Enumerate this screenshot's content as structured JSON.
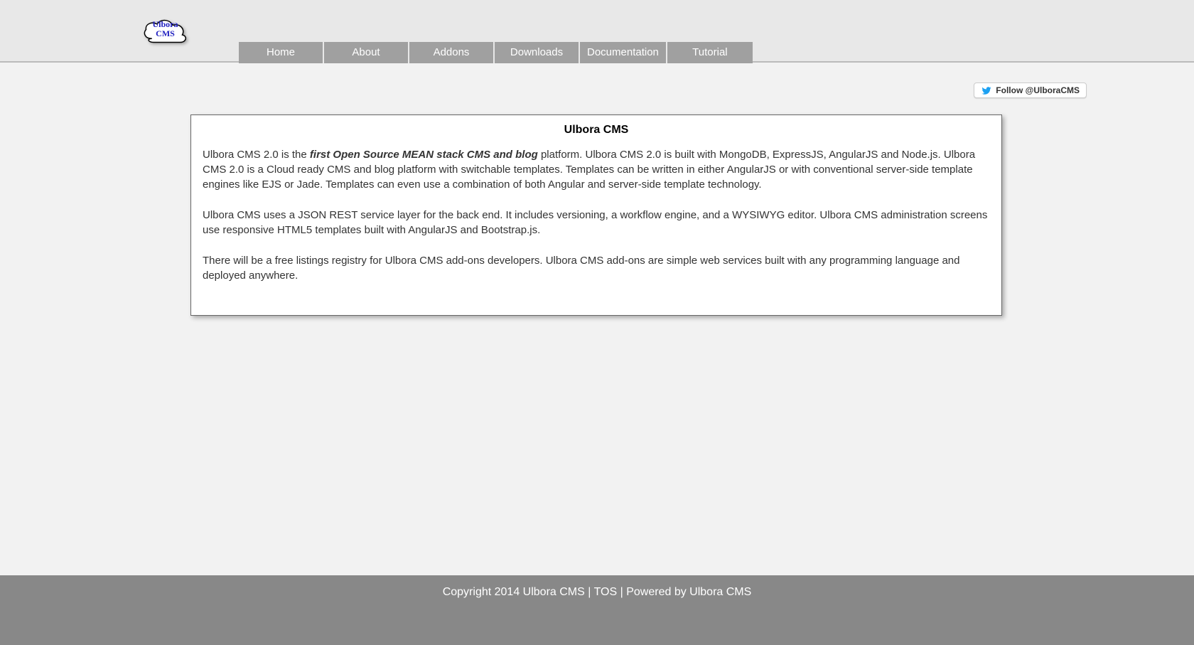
{
  "logo": {
    "line1": "Ulbora",
    "line2": "CMS"
  },
  "nav": {
    "items": [
      {
        "label": "Home"
      },
      {
        "label": "About"
      },
      {
        "label": "Addons"
      },
      {
        "label": "Downloads"
      },
      {
        "label": "Documentation"
      },
      {
        "label": "Tutorial"
      }
    ]
  },
  "social": {
    "follow_label": "Follow @UlboraCMS"
  },
  "content": {
    "title": "Ulbora CMS",
    "para1_pre": "Ulbora CMS 2.0 is the ",
    "para1_emph": "first Open Source MEAN stack CMS and blog",
    "para1_post": " platform. Ulbora CMS 2.0 is built with MongoDB, ExpressJS, AngularJS and Node.js. Ulbora CMS 2.0 is a Cloud ready CMS and blog platform with switchable templates. Templates can be written in either AngularJS or with conventional server-side template engines like EJS or Jade. Templates can even use a combination of both Angular and server-side template technology.",
    "para2": "Ulbora CMS uses a JSON REST service layer for the back end. It includes versioning, a workflow engine, and a WYSIWYG editor. Ulbora CMS administration screens use responsive HTML5 templates built with AngularJS and Bootstrap.js.",
    "para3": "There will be a free listings registry for Ulbora CMS add-ons developers. Ulbora CMS add-ons are simple web services built with any programming language and deployed anywhere."
  },
  "footer": {
    "copyright": "Copyright 2014 Ulbora CMS",
    "sep": " | ",
    "tos_label": "TOS",
    "powered_pre": "Powered by ",
    "powered_link": "Ulbora CMS"
  }
}
